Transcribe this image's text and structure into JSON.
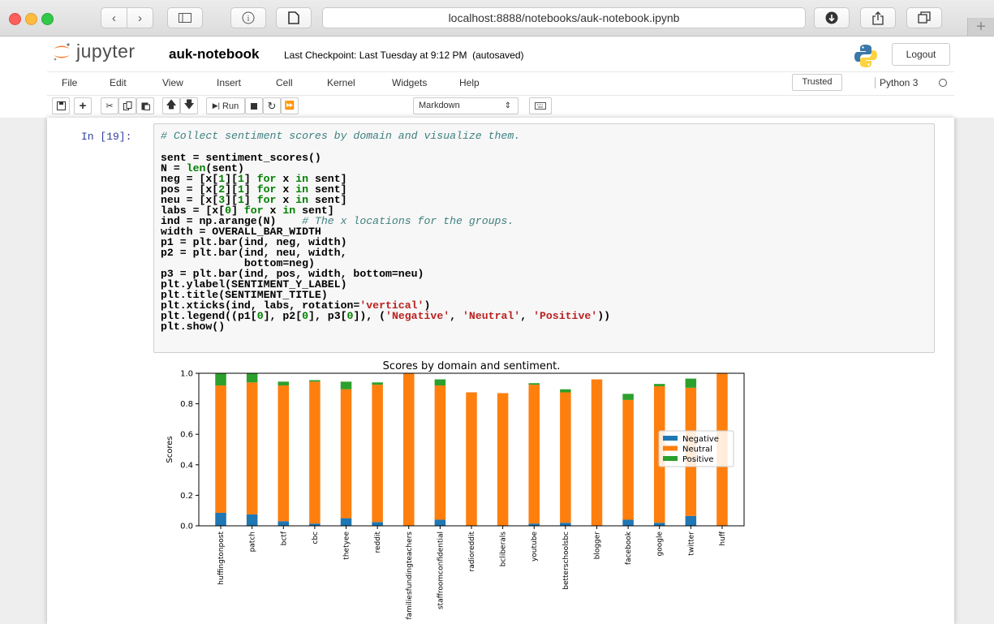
{
  "browser": {
    "url": "localhost:8888/notebooks/auk-notebook.ipynb",
    "new_tab": "+"
  },
  "jupyter": {
    "logo_text": "jupyter",
    "notebook_name": "auk-notebook",
    "checkpoint": "Last Checkpoint: Last Tuesday at 9:12 PM",
    "autosave": "(autosaved)",
    "logout_label": "Logout",
    "menu": [
      "File",
      "Edit",
      "View",
      "Insert",
      "Cell",
      "Kernel",
      "Widgets",
      "Help"
    ],
    "trusted_label": "Trusted",
    "kernel_name": "Python 3",
    "run_label": "Run",
    "cell_type": "Markdown"
  },
  "cell": {
    "prompt": "In [19]:"
  },
  "chart_data": {
    "type": "bar",
    "stacked": true,
    "title": "Scores by domain and sentiment.",
    "ylabel": "Scores",
    "xlabel": "",
    "ylim": [
      0,
      1.0
    ],
    "yticks": [
      "0.0",
      "0.2",
      "0.4",
      "0.6",
      "0.8",
      "1.0"
    ],
    "categories": [
      "huffingtonpost",
      "patch",
      "bctf",
      "cbc",
      "thetyee",
      "reddit",
      "familiesfundingteachers",
      "staffroomconfidential",
      "radioreddit",
      "bcliberals",
      "youtube",
      "betterschoolsbc",
      "blogger",
      "facebook",
      "google",
      "twitter",
      "huff"
    ],
    "series": [
      {
        "name": "Negative",
        "color": "#1f77b4",
        "values": [
          0.085,
          0.075,
          0.03,
          0.015,
          0.05,
          0.025,
          0.0,
          0.04,
          0.0,
          0.0,
          0.015,
          0.02,
          0.0,
          0.04,
          0.02,
          0.065,
          0.0
        ]
      },
      {
        "name": "Neutral",
        "color": "#ff7f0e",
        "values": [
          0.835,
          0.865,
          0.89,
          0.93,
          0.845,
          0.9,
          1.0,
          0.88,
          0.875,
          0.87,
          0.91,
          0.855,
          0.96,
          0.785,
          0.895,
          0.84,
          1.0
        ]
      },
      {
        "name": "Positive",
        "color": "#2ca02c",
        "values": [
          0.085,
          0.08,
          0.025,
          0.01,
          0.05,
          0.015,
          0.0,
          0.04,
          0.0,
          0.0,
          0.01,
          0.02,
          0.0,
          0.04,
          0.015,
          0.06,
          0.0
        ]
      }
    ],
    "legend_position": "right"
  }
}
